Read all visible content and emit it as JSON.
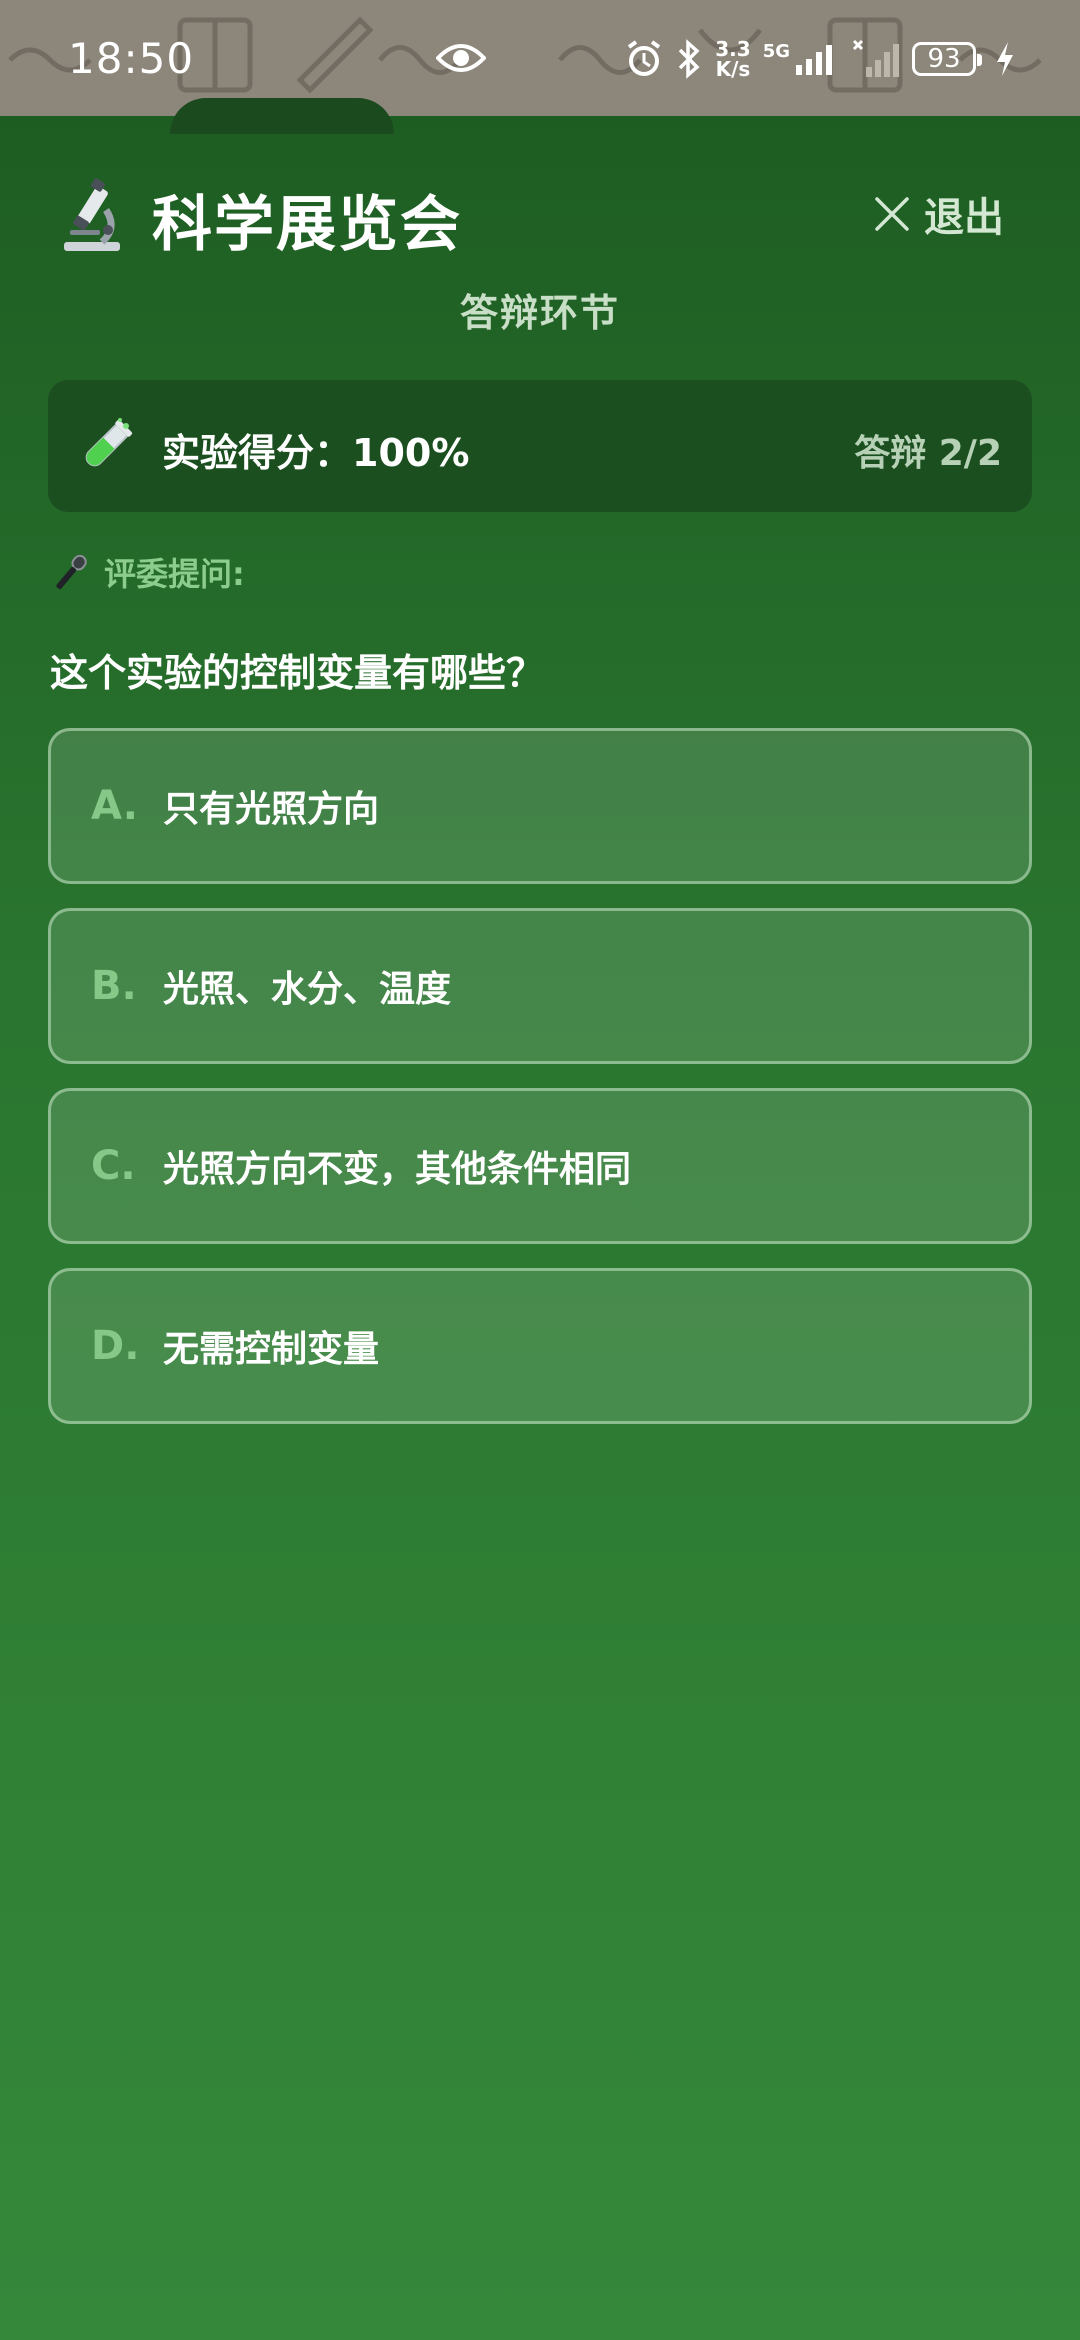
{
  "status_bar": {
    "time": "18:50",
    "net_speed_value": "3.3",
    "net_speed_unit": "K/s",
    "network_type": "5G",
    "battery_level": "93"
  },
  "header": {
    "title": "科学展览会",
    "exit_label": "退出",
    "subtitle": "答辩环节"
  },
  "score_card": {
    "score_text": "实验得分：100%",
    "progress_text": "答辩 2/2"
  },
  "question": {
    "judge_label": "评委提问:",
    "text": "这个实验的控制变量有哪些？",
    "options": [
      {
        "letter": "A.",
        "text": "只有光照方向"
      },
      {
        "letter": "B.",
        "text": "光照、水分、温度"
      },
      {
        "letter": "C.",
        "text": "光照方向不变，其他条件相同"
      },
      {
        "letter": "D.",
        "text": "无需控制变量"
      }
    ]
  },
  "colors": {
    "background_top": "#1e5d22",
    "background_bottom": "#35883a",
    "score_card": "#1c4f20",
    "option_letter": "#86c888",
    "judge_label": "#8ccd8e"
  },
  "icons": {
    "header": "microscope-icon",
    "score": "test-tube-icon",
    "judge": "microphone-icon",
    "exit": "close-icon"
  }
}
